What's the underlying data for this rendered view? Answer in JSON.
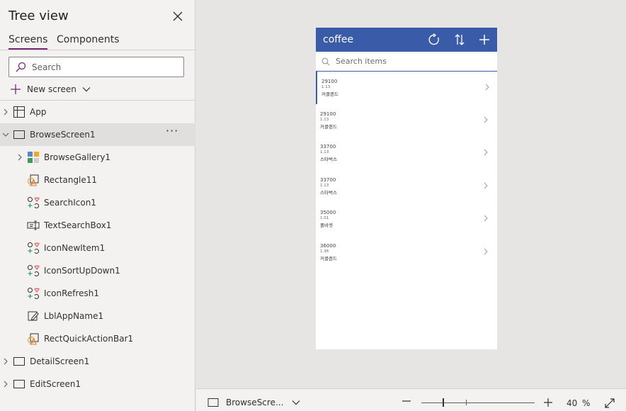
{
  "panel": {
    "title": "Tree view",
    "tabs": [
      {
        "label": "Screens",
        "active": true
      },
      {
        "label": "Components",
        "active": false
      }
    ],
    "search_placeholder": "Search",
    "new_screen_label": "New screen",
    "accent_color": "#742774"
  },
  "tree": {
    "app": {
      "label": "App"
    },
    "browse_screen": {
      "label": "BrowseScreen1",
      "selected": true
    },
    "controls": [
      {
        "label": "BrowseGallery1",
        "icon": "gallery-icon"
      },
      {
        "label": "Rectangle11",
        "icon": "shape-icon"
      },
      {
        "label": "SearchIcon1",
        "icon": "icons-icon"
      },
      {
        "label": "TextSearchBox1",
        "icon": "text-input-icon"
      },
      {
        "label": "IconNewItem1",
        "icon": "icons-icon"
      },
      {
        "label": "IconSortUpDown1",
        "icon": "icons-icon"
      },
      {
        "label": "IconRefresh1",
        "icon": "icons-icon"
      },
      {
        "label": "LblAppName1",
        "icon": "label-icon"
      },
      {
        "label": "RectQuickActionBar1",
        "icon": "shape-icon"
      }
    ],
    "detail_screen": {
      "label": "DetailScreen1"
    },
    "edit_screen": {
      "label": "EditScreen1"
    }
  },
  "app_preview": {
    "title": "coffee",
    "header_color": "#3a5ba8",
    "search_placeholder": "Search items",
    "items": [
      {
        "title": "29100",
        "subtitle": "1.13",
        "body": "커클랜드"
      },
      {
        "title": "29100",
        "subtitle": "1.13",
        "body": "커클랜드"
      },
      {
        "title": "33700",
        "subtitle": "1.13",
        "body": "스타벅스"
      },
      {
        "title": "33700",
        "subtitle": "1.13",
        "body": "스타벅스"
      },
      {
        "title": "35000",
        "subtitle": "1.01",
        "body": "폴바셋"
      },
      {
        "title": "36000",
        "subtitle": "1.36",
        "body": "커클랜드"
      }
    ]
  },
  "statusbar": {
    "screen_label": "BrowseScre...",
    "zoom_value": "40",
    "zoom_unit": "%"
  }
}
